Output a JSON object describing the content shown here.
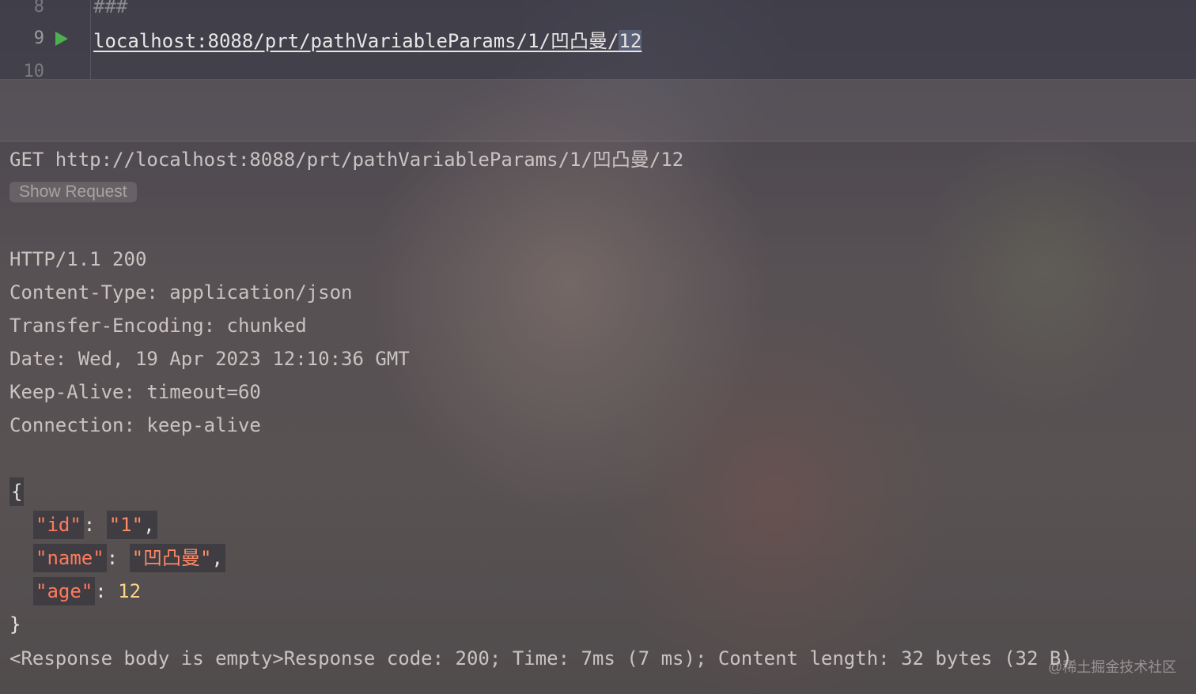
{
  "editor": {
    "lines": [
      {
        "number": "8",
        "content": "###"
      },
      {
        "number": "9",
        "url_main": "localhost:8088/prt/pathVariableParams/1/凹凸曼/",
        "url_selected": "12",
        "run_icon": "run-play-icon"
      },
      {
        "number": "10",
        "content": ""
      }
    ]
  },
  "response": {
    "request_line": "GET http://localhost:8088/prt/pathVariableParams/1/凹凸曼/12",
    "show_request_label": "Show Request",
    "status_line": "HTTP/1.1 200",
    "headers": [
      "Content-Type: application/json",
      "Transfer-Encoding: chunked",
      "Date: Wed, 19 Apr 2023 12:10:36 GMT",
      "Keep-Alive: timeout=60",
      "Connection: keep-alive"
    ],
    "json_open": "{",
    "json_close": "}",
    "body": [
      {
        "key": "\"id\"",
        "value": "\"1\"",
        "type": "string",
        "trailing": ","
      },
      {
        "key": "\"name\"",
        "value": "\"凹凸曼\"",
        "type": "string",
        "trailing": ","
      },
      {
        "key": "\"age\"",
        "value": "12",
        "type": "number",
        "trailing": ""
      }
    ],
    "footer": "<Response body is empty>Response code: 200; Time: 7ms (7 ms); Content length: 32 bytes (32 B)"
  },
  "watermark": "@稀土掘金技术社区",
  "colors": {
    "json_key": "#ff7a5c",
    "json_string": "#ff8a66",
    "json_number": "#ffd58a",
    "run_icon": "#4caf50"
  }
}
